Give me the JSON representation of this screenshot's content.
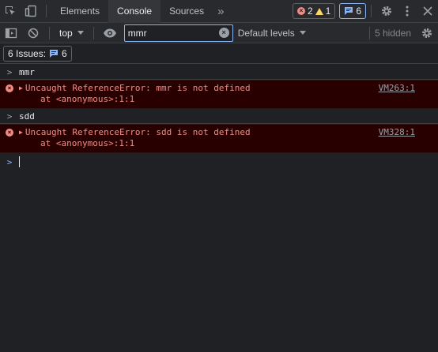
{
  "tabs": [
    {
      "label": "Elements"
    },
    {
      "label": "Console"
    },
    {
      "label": "Sources"
    }
  ],
  "more_tabs": "»",
  "counts": {
    "errors": "2",
    "warnings": "1",
    "messages": "6"
  },
  "toolbar": {
    "context": "top",
    "filter_value": "mmr",
    "levels": "Default levels",
    "hidden": "5 hidden"
  },
  "issues": {
    "label": "6 Issues:",
    "count": "6"
  },
  "console": {
    "entries": [
      {
        "command": "mmr"
      },
      {
        "error": "Uncaught ReferenceError: mmr is not defined",
        "trace": "at <anonymous>:1:1",
        "source": "VM263:1"
      },
      {
        "command": "sdd"
      },
      {
        "error": "Uncaught ReferenceError: sdd is not defined",
        "trace": "at <anonymous>:1:1",
        "source": "VM328:1"
      }
    ]
  },
  "colors": {
    "background": "#202124",
    "error_bg": "#290000",
    "error_text": "#f28b82",
    "accent": "#8ab4f8"
  }
}
